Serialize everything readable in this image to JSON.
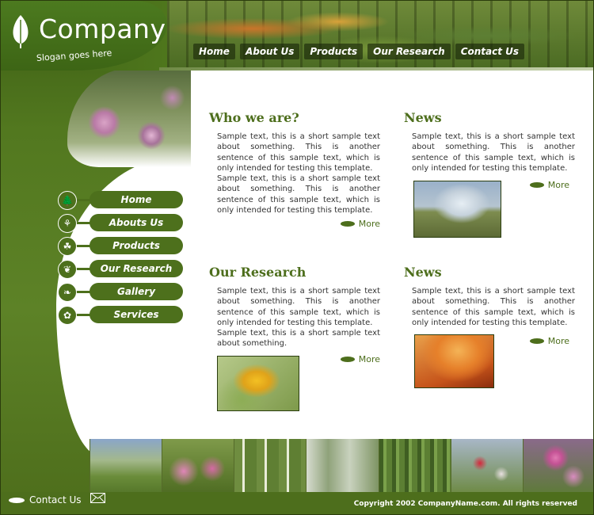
{
  "brand": {
    "name": "Company",
    "slogan": "Slogan goes here"
  },
  "top_nav": [
    {
      "label": "Home",
      "icon": null
    },
    {
      "label": "About Us"
    },
    {
      "label": "Products"
    },
    {
      "label": "Our Research"
    },
    {
      "label": "Contact Us"
    }
  ],
  "side_nav": [
    {
      "label": "Home",
      "icon": "tree-icon"
    },
    {
      "label": "Abouts Us",
      "icon": "grass-icon"
    },
    {
      "label": "Products",
      "icon": "maple-leaf-icon"
    },
    {
      "label": "Our Research",
      "icon": "sprout-icon"
    },
    {
      "label": "Gallery",
      "icon": "leaf-icon"
    },
    {
      "label": "Services",
      "icon": "flower-icon"
    }
  ],
  "blocks": {
    "who": {
      "title": "Who we are?",
      "p1": "Sample text, this is a short sample text about something. This is another sentence of this sample text, which is only intended for testing this template.",
      "p2": "Sample text, this is a short sample text about something. This is another sentence of this sample text, which is only intended for testing this template.",
      "more": "More"
    },
    "news1": {
      "title": "News",
      "p1": "Sample text, this is a short sample text about something. This is another sentence of this sample text, which is only intended for testing this template.",
      "more": "More"
    },
    "research": {
      "title": "Our Research",
      "p1": "Sample text, this is a short sample text about something. This is another sentence of this sample text, which is only intended for testing this template.",
      "p2": "Sample text, this is a short sample text about something.",
      "more": "More"
    },
    "news2": {
      "title": "News",
      "p1": "Sample text, this is a short sample text about something. This is another sentence of this sample text, which is only intended for testing this template.",
      "more": "More"
    }
  },
  "footer": {
    "contact": "Contact Us",
    "copyright": "Copyright 2002 CompanyName.com. All rights reserved"
  },
  "colors": {
    "brand_green": "#4d6e1c",
    "dark_green": "#3d6515"
  }
}
